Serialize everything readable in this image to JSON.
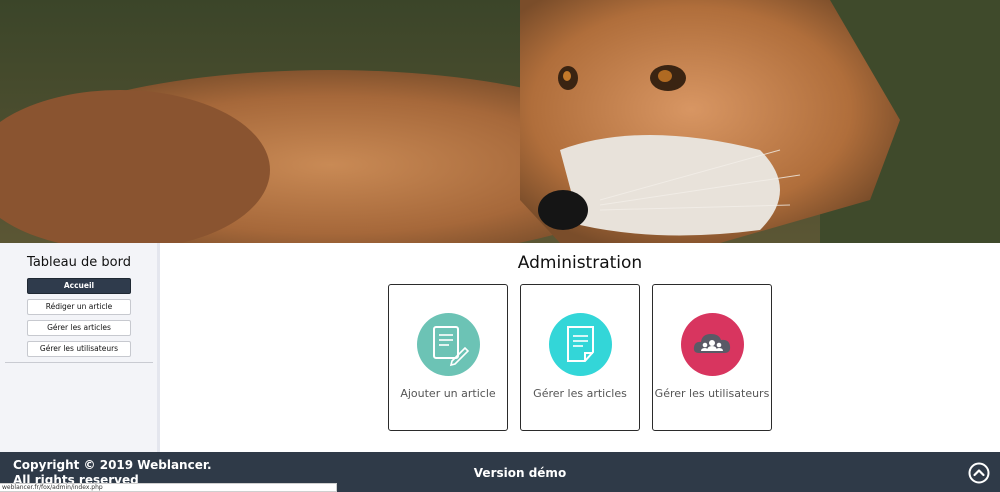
{
  "hero": {
    "image": "fox-photo"
  },
  "sidebar": {
    "title": "Tableau de bord",
    "items": [
      {
        "label": "Accueil",
        "active": true
      },
      {
        "label": "Rédiger un article",
        "active": false
      },
      {
        "label": "Gérer les articles",
        "active": false
      },
      {
        "label": "Gérer les utilisateurs",
        "active": false
      }
    ]
  },
  "main": {
    "title": "Administration",
    "cards": [
      {
        "label": "Ajouter un article",
        "icon": "edit-document-icon",
        "color": "#6cc3b5"
      },
      {
        "label": "Gérer les articles",
        "icon": "document-icon",
        "color": "#33d6d8"
      },
      {
        "label": "Gérer les utilisateurs",
        "icon": "users-cloud-icon",
        "color": "#d8355f"
      }
    ]
  },
  "footer": {
    "copyright_line1": "Copyright © 2019 Weblancer.",
    "copyright_line2": "All rights reserved",
    "version": "Version démo",
    "back_to_top_icon": "chevron-up-circle-icon",
    "background": "#2f3a48"
  },
  "statusbar": {
    "url": "weblancer.fr/fox/admin/index.php"
  }
}
